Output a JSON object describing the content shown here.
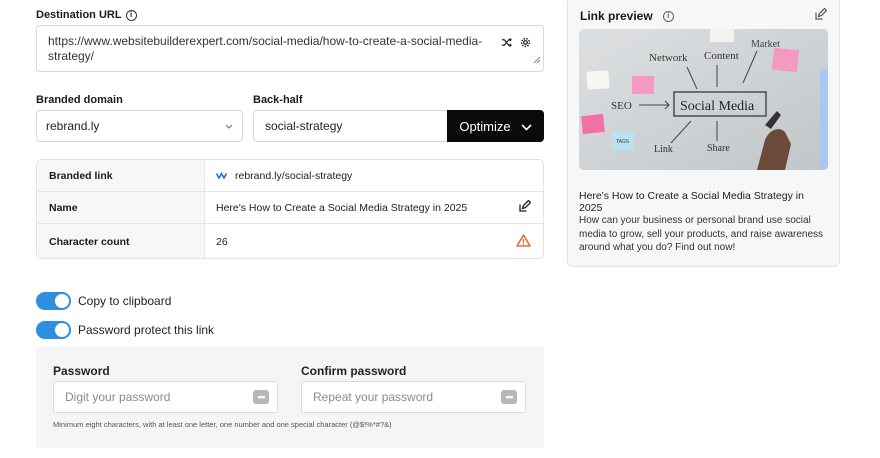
{
  "destination": {
    "label": "Destination URL",
    "info_icon": "info-circle-icon",
    "url": "https://www.websitebuilderexpert.com/social-media/how-to-create-a-social-media-strategy/",
    "shuffle_icon": "shuffle-icon",
    "settings_icon": "gear-icon"
  },
  "branded_domain": {
    "label": "Branded domain",
    "value": "rebrand.ly",
    "chevron_icon": "chevron-down-icon"
  },
  "back_half": {
    "label": "Back-half",
    "value": "social-strategy",
    "optimize_label": "Optimize"
  },
  "info_table": {
    "rows": [
      {
        "key": "Branded link",
        "value": "rebrand.ly/social-strategy",
        "icon": "rebrandly-logo-icon"
      },
      {
        "key": "Name",
        "value": "Here's How to Create a Social Media Strategy in 2025",
        "icon": "edit-icon"
      },
      {
        "key": "Character count",
        "value": "26",
        "icon": "warning-icon"
      }
    ]
  },
  "toggles": {
    "copy_label": "Copy to clipboard",
    "copy_on": true,
    "password_label": "Password protect this link",
    "password_on": true
  },
  "password": {
    "label": "Password",
    "placeholder": "Digit your password",
    "confirm_label": "Confirm password",
    "confirm_placeholder": "Repeat your password",
    "hint": "Minimum eight characters, with at least one letter, one number and one special character (@$!%*#?&)"
  },
  "preview": {
    "label": "Link preview",
    "title": "Here's How to Create a Social Media Strategy in 2025",
    "description": "How can your business or personal brand use social media to grow, sell your products, and raise awareness around what you do? Find out now!",
    "image_words": [
      "Network",
      "Content",
      "Market",
      "SEO",
      "Social Media",
      "Link",
      "Share",
      "TAGS"
    ]
  },
  "colors": {
    "accent": "#2d8fe0",
    "button_dark": "#0a0a0a",
    "warning": "#e8541c"
  }
}
